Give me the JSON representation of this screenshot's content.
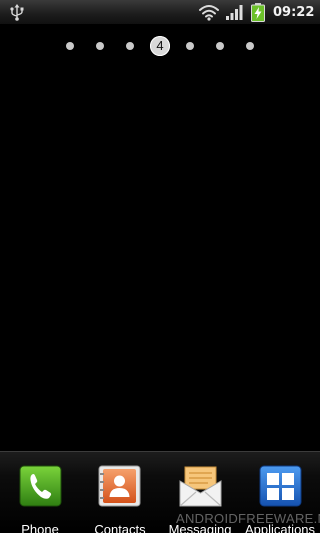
{
  "status_bar": {
    "time": "09:22",
    "icons": [
      "usb-icon",
      "wifi-icon",
      "signal-icon",
      "battery-charging-icon"
    ]
  },
  "home": {
    "page_indicator": {
      "total_pages": 7,
      "current_page": 4,
      "current_label": "4"
    }
  },
  "dock": {
    "items": [
      {
        "label": "Phone",
        "icon": "phone-icon"
      },
      {
        "label": "Contacts",
        "icon": "contacts-icon"
      },
      {
        "label": "Messaging",
        "icon": "messaging-icon"
      },
      {
        "label": "Applications",
        "icon": "applications-icon"
      }
    ]
  },
  "watermark": "ANDROIDFREEWARE.NET",
  "colors": {
    "battery_green": "#6cc12a",
    "phone_green": "#3f9a1c",
    "contacts_orange": "#f07c3e",
    "applications_blue": "#1f6fd1"
  }
}
